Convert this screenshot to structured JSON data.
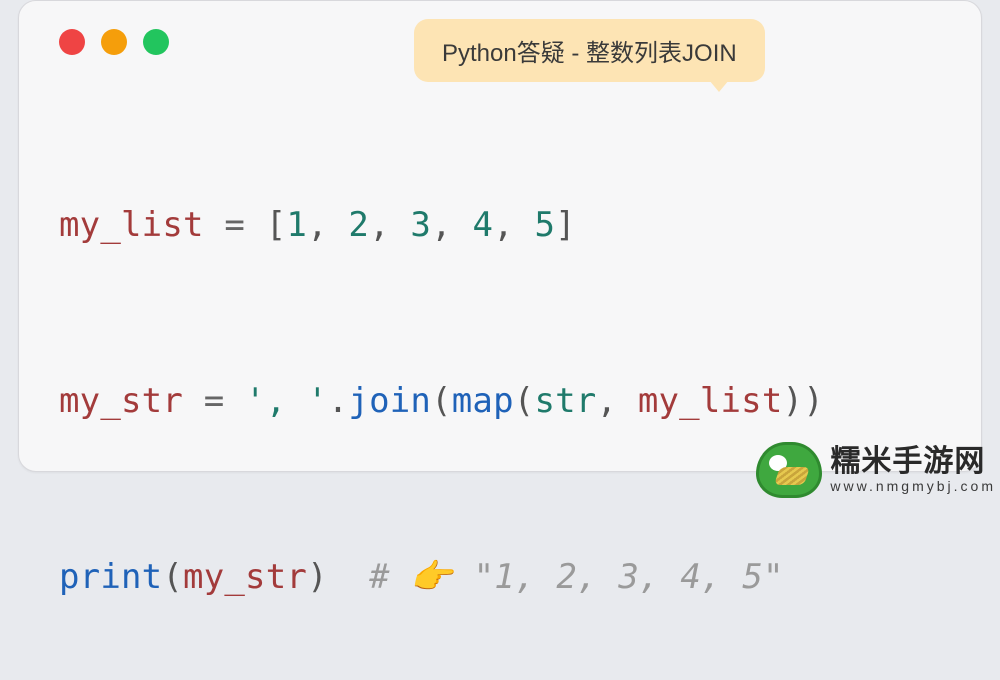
{
  "title": "Python答疑 - 整数列表JOIN",
  "code": {
    "line1": {
      "var": "my_list",
      "eq": " = ",
      "lb": "[",
      "n1": "1",
      "c1": ", ",
      "n2": "2",
      "c2": ", ",
      "n3": "3",
      "c3": ", ",
      "n4": "4",
      "c4": ", ",
      "n5": "5",
      "rb": "]"
    },
    "line2": {
      "var": "my_str",
      "eq": " = ",
      "q1": "'",
      "sep": ", ",
      "q2": "'",
      "dot": ".",
      "join": "join",
      "lp": "(",
      "map": "map",
      "lp2": "(",
      "str": "str",
      "comma": ", ",
      "arg": "my_list",
      "rp2": ")",
      "rp": ")"
    },
    "line3": {
      "print": "print",
      "lp": "(",
      "arg": "my_str",
      "rp": ")",
      "sp": "  ",
      "hash": "# ",
      "emoji": "👉 ",
      "out": "\"1, 2, 3, 4, 5\""
    }
  },
  "watermark": {
    "cn": "糯米手游网",
    "url": "www.nmgmybj.com"
  }
}
